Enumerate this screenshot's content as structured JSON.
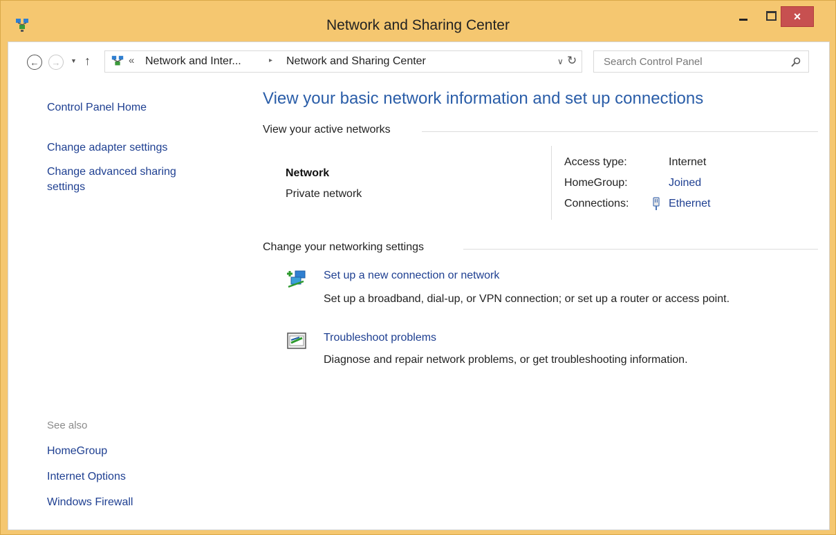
{
  "window": {
    "title": "Network and Sharing Center",
    "close_glyph": "×"
  },
  "address_bar": {
    "lead": "«",
    "crumbs": [
      "Network and Inter...",
      "Network and Sharing Center"
    ],
    "separator": "▸",
    "dropdown": "∨",
    "refresh": "↻"
  },
  "search": {
    "placeholder": "Search Control Panel"
  },
  "nav": {
    "back": "←",
    "forward": "→",
    "history": "▼",
    "up": "↑"
  },
  "sidebar": {
    "home": "Control Panel Home",
    "links": [
      "Change adapter settings",
      "Change advanced sharing settings"
    ],
    "see_also_label": "See also",
    "see_also": [
      "HomeGroup",
      "Internet Options",
      "Windows Firewall"
    ]
  },
  "main": {
    "heading": "View your basic network information and set up connections",
    "active_networks_label": "View your active networks",
    "network": {
      "name": "Network",
      "type": "Private network",
      "access_type_label": "Access type:",
      "access_type_value": "Internet",
      "homegroup_label": "HomeGroup:",
      "homegroup_value": "Joined",
      "connections_label": "Connections:",
      "connections_value": "Ethernet"
    },
    "change_settings_label": "Change your networking settings",
    "tasks": [
      {
        "title": "Set up a new connection or network",
        "desc": "Set up a broadband, dial-up, or VPN connection; or set up a router or access point.",
        "icon": "new-connection-icon"
      },
      {
        "title": "Troubleshoot problems",
        "desc": "Diagnose and repair network problems, or get troubleshooting information.",
        "icon": "troubleshoot-icon"
      }
    ]
  },
  "colors": {
    "frame": "#f5c770",
    "link": "#1e3f91",
    "heading": "#2a5da8",
    "close_button": "#c75050"
  }
}
